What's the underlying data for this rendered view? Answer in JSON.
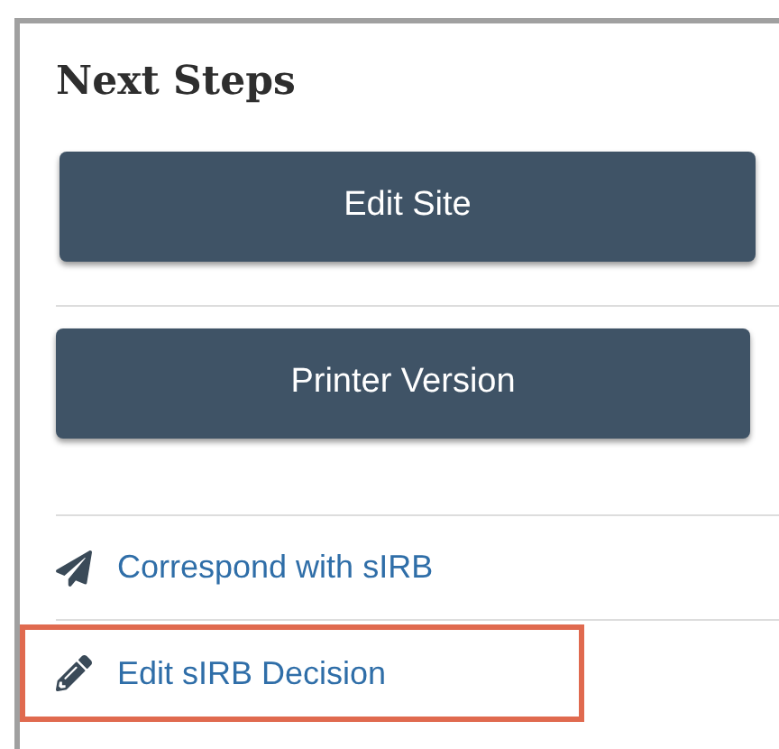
{
  "panel": {
    "title": "Next Steps"
  },
  "buttons": [
    "Edit Site",
    "Printer Version"
  ],
  "links": [
    {
      "kind": "send",
      "label": "Correspond with sIRB",
      "highlighted": false
    },
    {
      "kind": "edit",
      "label": "Edit sIRB Decision",
      "highlighted": true
    }
  ]
}
